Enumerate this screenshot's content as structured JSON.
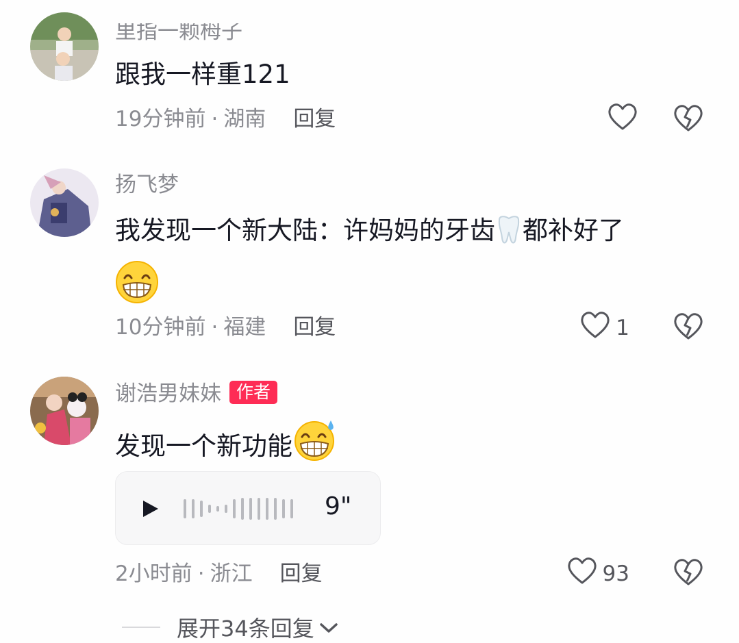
{
  "comments": [
    {
      "username": "里指一颗栂子",
      "text": "跟我一样重121",
      "time": "19分钟前",
      "location": "湖南",
      "reply_label": "回复",
      "likes": ""
    },
    {
      "username": "扬飞梦",
      "text_before": "我发现一个新大陆：许妈妈的牙齿",
      "text_after": "都补好了",
      "emoji_inline": "tooth-emoji",
      "emoji_end": "grin-emoji",
      "time": "10分钟前",
      "location": "福建",
      "reply_label": "回复",
      "likes": "1"
    },
    {
      "username": "谢浩男妹妹",
      "badge": "作者",
      "text": "发现一个新功能",
      "emoji_end": "grin-sweat-emoji",
      "voice_duration": "9\"",
      "time": "2小时前",
      "location": "浙江",
      "reply_label": "回复",
      "likes": "93"
    }
  ],
  "separator": "·",
  "expand_label": "展开34条回复",
  "colors": {
    "badge": "#fe2c55",
    "secondary_text": "#8a8b91",
    "primary_text": "#161823"
  }
}
